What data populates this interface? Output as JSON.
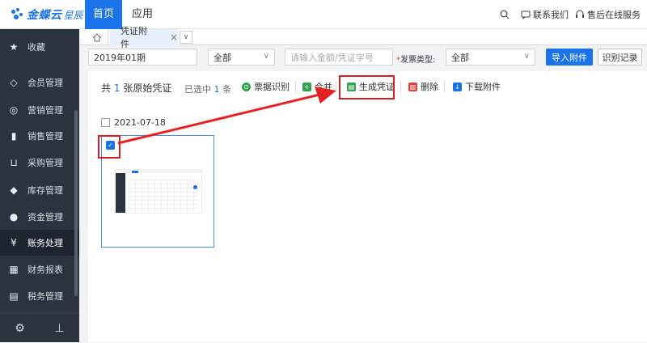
{
  "brand": {
    "name": "金蝶云",
    "edition": "星辰"
  },
  "topnav": {
    "home": "首页",
    "apps": "应用"
  },
  "top_right": {
    "contact": "联系我们",
    "service": "售后在线服务"
  },
  "sidebar": {
    "items": [
      {
        "label": "收藏",
        "icon": "star-icon"
      },
      {
        "label": "会员管理",
        "icon": "diamond-icon"
      },
      {
        "label": "营销管理",
        "icon": "target-icon"
      },
      {
        "label": "销售管理",
        "icon": "bar-chart-icon"
      },
      {
        "label": "采购管理",
        "icon": "cart-icon"
      },
      {
        "label": "库存管理",
        "icon": "box-icon"
      },
      {
        "label": "资金管理",
        "icon": "coin-icon"
      },
      {
        "label": "账务处理",
        "icon": "ledger-icon"
      },
      {
        "label": "财务报表",
        "icon": "report-icon"
      },
      {
        "label": "税务管理",
        "icon": "tax-icon"
      }
    ],
    "active_index": 7
  },
  "tabs": {
    "active": "凭证附件"
  },
  "filters": {
    "period": "2019年01期",
    "scope": "全部",
    "search_placeholder": "请输入金额/凭证字号",
    "invoice_type_label": "发票类型:",
    "invoice_type_value": "全部"
  },
  "buttons": {
    "import": "导入附件",
    "records": "识别记录"
  },
  "summary": {
    "prefix": "共",
    "count": "1",
    "suffix": "张原始凭证",
    "sel_prefix": "已选中",
    "sel_count": "1",
    "sel_suffix": "条"
  },
  "toolbar": {
    "recognize": "票据识别",
    "merge": "合并",
    "generate": "生成凭证",
    "delete": "删除",
    "download": "下载附件"
  },
  "group_date": "2021-07-18",
  "colors": {
    "accent": "#1a73e8",
    "highlight": "#d81e1e",
    "sidebar": "#2c3340"
  }
}
